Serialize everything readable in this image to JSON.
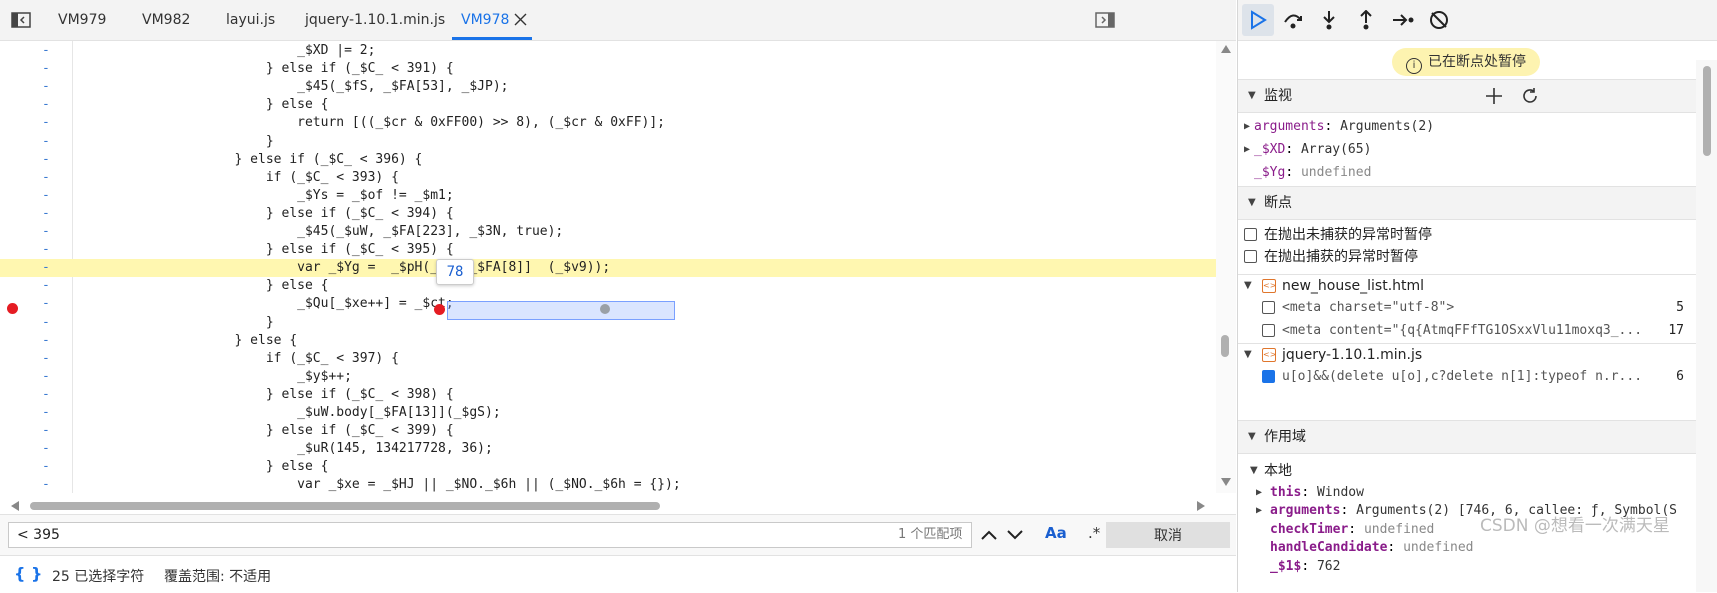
{
  "tabs": [
    {
      "label": "VM979",
      "active": false
    },
    {
      "label": "VM982",
      "active": false
    },
    {
      "label": "layui.js",
      "active": false
    },
    {
      "label": "jquery-1.10.1.min.js",
      "active": false
    },
    {
      "label": "VM978",
      "active": true
    }
  ],
  "code_lines": [
    {
      "text": "                            _$XD |= 2;",
      "highlight": false
    },
    {
      "text": "                        } else if (_$C_ < 391) {",
      "highlight": false
    },
    {
      "text": "                            _$45(_$fS, _$FA[53], _$JP);",
      "highlight": false
    },
    {
      "text": "                        } else {",
      "highlight": false
    },
    {
      "text": "                            return [((_$cr & 0xFF00) >> 8), (_$cr & 0xFF)];",
      "highlight": false
    },
    {
      "text": "                        }",
      "highlight": false
    },
    {
      "text": "                    } else if (_$C_ < 396) {",
      "highlight": false
    },
    {
      "text": "                        if (_$C_ < 393) {",
      "highlight": false
    },
    {
      "text": "                            _$Ys = _$of != _$m1;",
      "highlight": false
    },
    {
      "text": "                        } else if (_$C_ < 394) {",
      "highlight": false
    },
    {
      "text": "                            _$45(_$uW, _$FA[223], _$3N, true);",
      "highlight": false
    },
    {
      "text": "                        } else if (_$C_ < 395) {",
      "highlight": false
    },
    {
      "text": "                            var _$Yg =  _$pH(_$XD[_$FA[8]]  (_$v9));",
      "highlight": true
    },
    {
      "text": "                        } else {",
      "highlight": false
    },
    {
      "text": "                            _$Qu[_$xe++] = _$ct;",
      "highlight": false
    },
    {
      "text": "                        }",
      "highlight": false
    },
    {
      "text": "                    } else {",
      "highlight": false
    },
    {
      "text": "                        if (_$C_ < 397) {",
      "highlight": false
    },
    {
      "text": "                            _$y$++;",
      "highlight": false
    },
    {
      "text": "                        } else if (_$C_ < 398) {",
      "highlight": false
    },
    {
      "text": "                            _$uW.body[_$FA[13]](_$gS);",
      "highlight": false
    },
    {
      "text": "                        } else if (_$C_ < 399) {",
      "highlight": false
    },
    {
      "text": "                            _$uR(145, 134217728, 36);",
      "highlight": false
    },
    {
      "text": "                        } else {",
      "highlight": false
    },
    {
      "text": "                            var _$xe = _$HJ || _$NO._$6h || (_$NO._$6h = {});",
      "highlight": false
    }
  ],
  "gutter_marker": "-",
  "hover_tooltip": "78",
  "search": {
    "value": "< 395",
    "match_count": "1 个匹配项",
    "case_label": "Aa",
    "regex_label": ".*",
    "cancel_label": "取消"
  },
  "status": {
    "brace_icon": "{ }",
    "selected_chars": "25 已选择字符",
    "coverage": "覆盖范围: 不适用"
  },
  "debugger": {
    "paused_label": "已在断点处暂停",
    "watch": {
      "header": "监视",
      "items": [
        {
          "name": "arguments",
          "value": "Arguments(2)",
          "expandable": true,
          "undefined": false
        },
        {
          "name": "_$XD",
          "value": "Array(65)",
          "expandable": true,
          "undefined": false
        },
        {
          "name": "_$Yg",
          "value": "undefined",
          "expandable": false,
          "undefined": true
        }
      ]
    },
    "breakpoints": {
      "header": "断点",
      "options": [
        {
          "label": "在抛出未捕获的异常时暂停",
          "checked": false
        },
        {
          "label": "在抛出捕获的异常时暂停",
          "checked": false
        }
      ],
      "files": [
        {
          "file": "new_house_list.html",
          "entries": [
            {
              "code": "<meta charset=\"utf-8\">",
              "line": "5",
              "checked": false
            },
            {
              "code": "<meta content=\"{q{AtmqFFfTG1OSxxVlu11moxq3_...",
              "line": "17",
              "checked": false
            }
          ]
        },
        {
          "file": "jquery-1.10.1.min.js",
          "entries": [
            {
              "code": "u[o]&&(delete u[o],c?delete n[1]:typeof n.r...",
              "line": "6",
              "checked": true
            }
          ]
        }
      ]
    },
    "scope": {
      "header": "作用域",
      "local_label": "本地",
      "items": [
        {
          "name": "this",
          "value": "Window",
          "expandable": true,
          "undefined": false
        },
        {
          "name": "arguments",
          "value": "Arguments(2) [746, 6, callee: ƒ, Symbol(S",
          "expandable": true,
          "undefined": false
        },
        {
          "name": "checkTimer",
          "value": "undefined",
          "expandable": false,
          "undefined": true
        },
        {
          "name": "handleCandidate",
          "value": "undefined",
          "expandable": false,
          "undefined": true
        },
        {
          "name": "_$1$",
          "value": "762",
          "expandable": false,
          "undefined": false
        }
      ]
    }
  },
  "watermark": "CSDN @想看一次满天星",
  "colors": {
    "accent": "#1a73e8",
    "highlight_line": "#fff7b0",
    "breakpoint": "#e51c23",
    "paused_badge": "#fdf3b0"
  }
}
